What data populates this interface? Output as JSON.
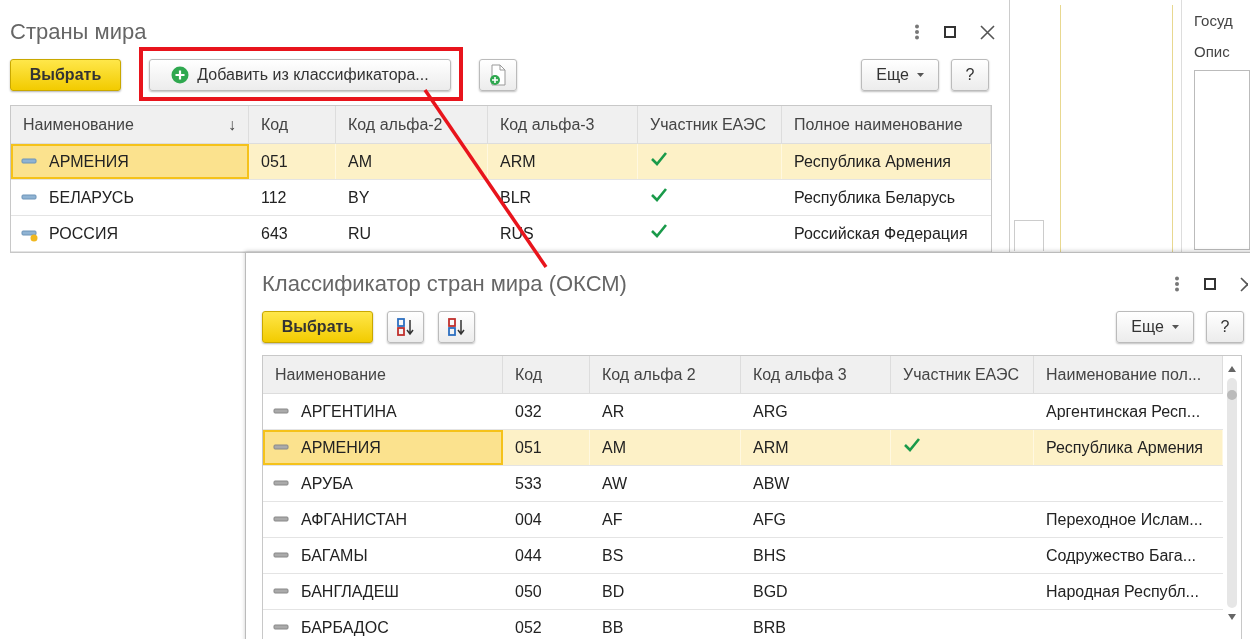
{
  "main_window": {
    "title": "Страны мира",
    "toolbar": {
      "choose_button": "Выбрать",
      "add_button": "Добавить из классификатора...",
      "more_button": "Еще",
      "help_button": "?"
    },
    "table": {
      "columns": [
        {
          "label": "Наименование",
          "sort": "↓"
        },
        {
          "label": "Код"
        },
        {
          "label": "Код альфа-2"
        },
        {
          "label": "Код альфа-3"
        },
        {
          "label": "Участник ЕАЭС"
        },
        {
          "label": "Полное наименование"
        }
      ],
      "rows": [
        {
          "name": "АРМЕНИЯ",
          "code": "051",
          "alpha2": "AM",
          "alpha3": "ARM",
          "eaeu": true,
          "full_name": "Республика Армения",
          "selected": true,
          "marked": false
        },
        {
          "name": "БЕЛАРУСЬ",
          "code": "112",
          "alpha2": "BY",
          "alpha3": "BLR",
          "eaeu": true,
          "full_name": "Республика Беларусь",
          "selected": false,
          "marked": false
        },
        {
          "name": "РОССИЯ",
          "code": "643",
          "alpha2": "RU",
          "alpha3": "RUS",
          "eaeu": true,
          "full_name": "Российская Федерация",
          "selected": false,
          "marked": true
        }
      ]
    }
  },
  "side_panel": {
    "labels": [
      "Госуд",
      "Опис"
    ]
  },
  "classifier_window": {
    "title": "Классификатор стран мира (ОКСМ)",
    "toolbar": {
      "choose_button": "Выбрать",
      "more_button": "Еще",
      "help_button": "?"
    },
    "table": {
      "columns": [
        {
          "label": "Наименование"
        },
        {
          "label": "Код"
        },
        {
          "label": "Код альфа 2"
        },
        {
          "label": "Код альфа 3"
        },
        {
          "label": "Участник ЕАЭС"
        },
        {
          "label": "Наименование пол..."
        }
      ],
      "rows": [
        {
          "name": "АРГЕНТИНА",
          "code": "032",
          "alpha2": "AR",
          "alpha3": "ARG",
          "eaeu": false,
          "full_name": "Аргентинская Респ...",
          "selected": false
        },
        {
          "name": "АРМЕНИЯ",
          "code": "051",
          "alpha2": "AM",
          "alpha3": "ARM",
          "eaeu": true,
          "full_name": "Республика Армения",
          "selected": true
        },
        {
          "name": "АРУБА",
          "code": "533",
          "alpha2": "AW",
          "alpha3": "ABW",
          "eaeu": false,
          "selected": false
        },
        {
          "name": "АФГАНИСТАН",
          "code": "004",
          "alpha2": "AF",
          "alpha3": "AFG",
          "eaeu": false,
          "full_name": "Переходное Ислам...",
          "selected": false
        },
        {
          "name": "БАГАМЫ",
          "code": "044",
          "alpha2": "BS",
          "alpha3": "BHS",
          "eaeu": false,
          "full_name": "Содружество Бага...",
          "selected": false
        },
        {
          "name": "БАНГЛАДЕШ",
          "code": "050",
          "alpha2": "BD",
          "alpha3": "BGD",
          "eaeu": false,
          "full_name": "Народная Республ...",
          "selected": false
        },
        {
          "name": "БАРБАДОС",
          "code": "052",
          "alpha2": "BB",
          "alpha3": "BRB",
          "eaeu": false,
          "selected": false
        }
      ]
    }
  }
}
